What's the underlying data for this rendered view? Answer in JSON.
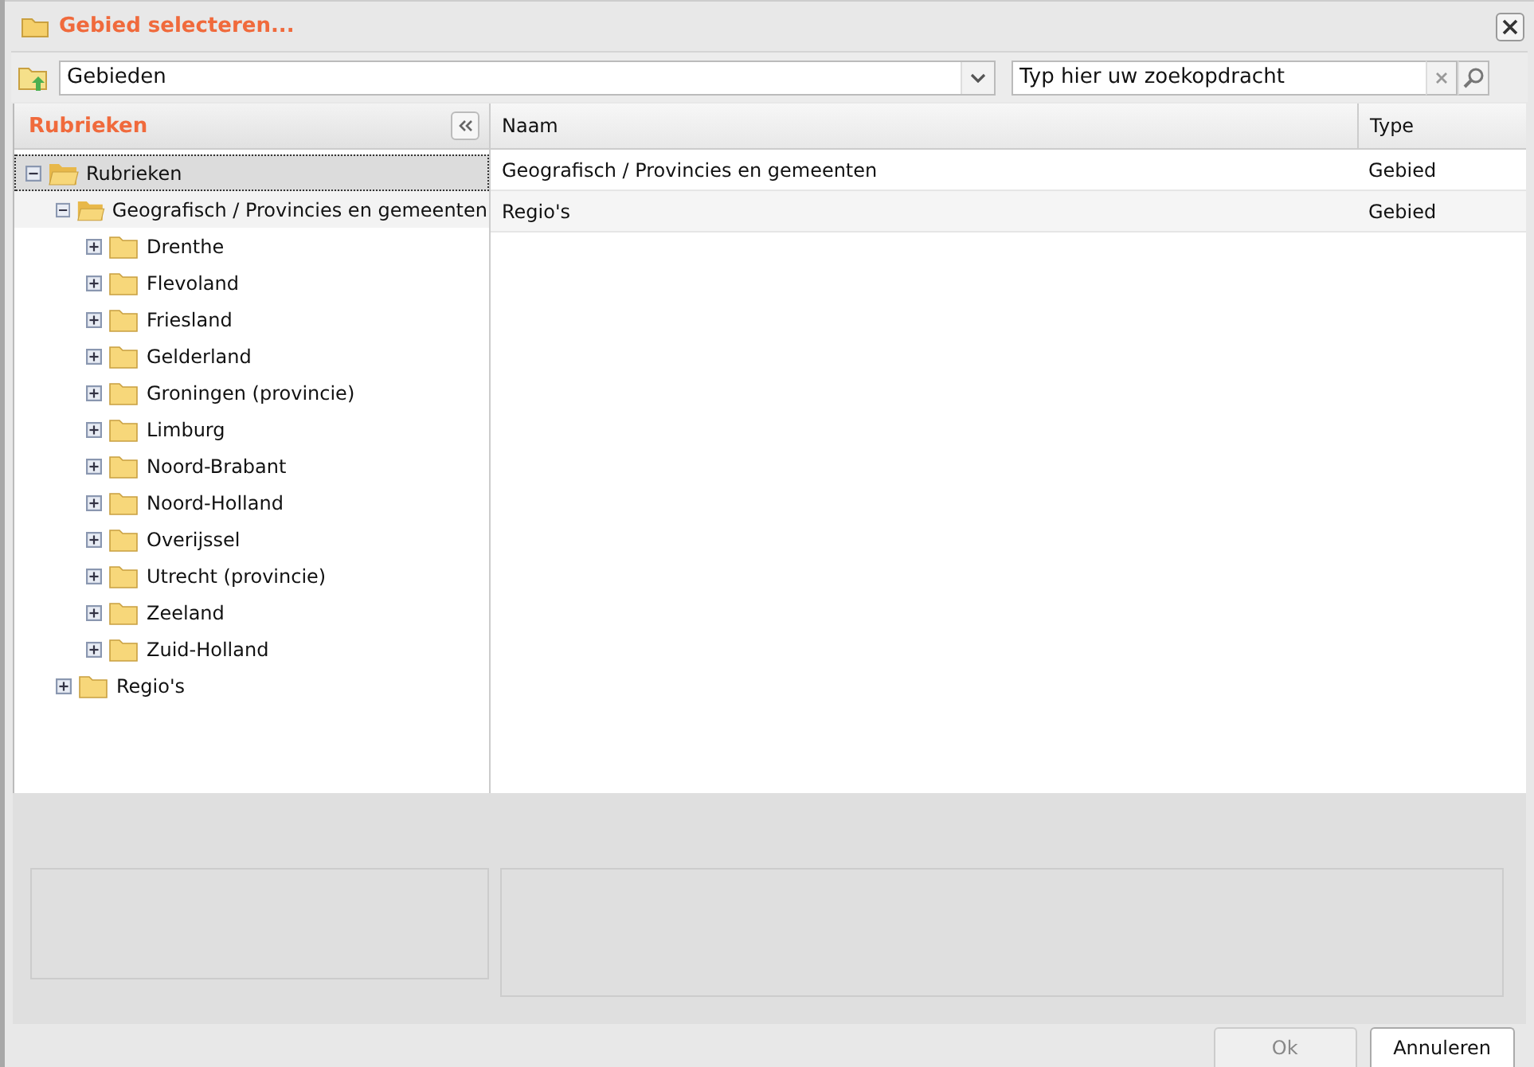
{
  "window": {
    "title": "Gebied selecteren..."
  },
  "toolbar": {
    "dropdown": {
      "value": "Gebieden"
    },
    "search": {
      "placeholder": "Typ hier uw zoekopdracht"
    }
  },
  "sidebar": {
    "title": "Rubrieken",
    "tree": [
      {
        "label": "Rubrieken",
        "expanded": true,
        "selected": true,
        "hovered": false,
        "children": [
          {
            "label": "Geografisch / Provincies en gemeenten",
            "expanded": true,
            "selected": false,
            "hovered": true,
            "children": [
              {
                "label": "Drenthe",
                "expanded": false,
                "selected": false,
                "hovered": false
              },
              {
                "label": "Flevoland",
                "expanded": false,
                "selected": false,
                "hovered": false
              },
              {
                "label": "Friesland",
                "expanded": false,
                "selected": false,
                "hovered": false
              },
              {
                "label": "Gelderland",
                "expanded": false,
                "selected": false,
                "hovered": false
              },
              {
                "label": "Groningen (provincie)",
                "expanded": false,
                "selected": false,
                "hovered": false
              },
              {
                "label": "Limburg",
                "expanded": false,
                "selected": false,
                "hovered": false
              },
              {
                "label": "Noord-Brabant",
                "expanded": false,
                "selected": false,
                "hovered": false
              },
              {
                "label": "Noord-Holland",
                "expanded": false,
                "selected": false,
                "hovered": false
              },
              {
                "label": "Overijssel",
                "expanded": false,
                "selected": false,
                "hovered": false
              },
              {
                "label": "Utrecht (provincie)",
                "expanded": false,
                "selected": false,
                "hovered": false
              },
              {
                "label": "Zeeland",
                "expanded": false,
                "selected": false,
                "hovered": false
              },
              {
                "label": "Zuid-Holland",
                "expanded": false,
                "selected": false,
                "hovered": false
              }
            ]
          },
          {
            "label": "Regio's",
            "expanded": false,
            "selected": false,
            "hovered": false
          }
        ]
      }
    ]
  },
  "table": {
    "columns": [
      "Naam",
      "Type"
    ],
    "rows": [
      [
        "Geografisch / Provincies en gemeenten",
        "Gebied"
      ],
      [
        "Regio's",
        "Gebied"
      ]
    ]
  },
  "buttons": [
    {
      "label": "Ok",
      "disabled": true
    },
    {
      "label": "Annuleren",
      "disabled": false
    }
  ]
}
